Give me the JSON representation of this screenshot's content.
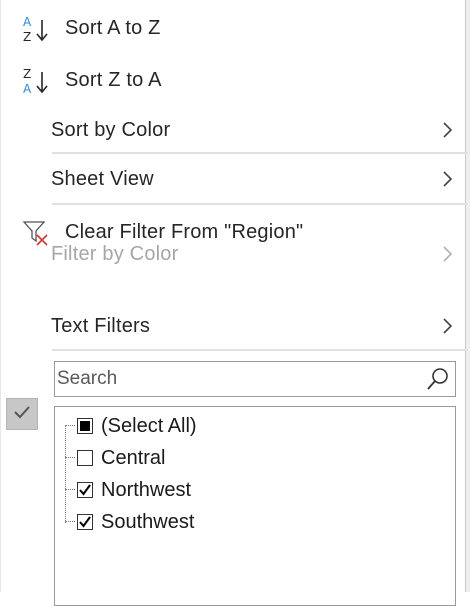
{
  "menu": {
    "sort_a_z": "Sort A to Z",
    "sort_z_a": "Sort Z to A",
    "sort_by_color": "Sort by Color",
    "sheet_view": "Sheet View",
    "clear_filter": "Clear Filter From \"Region\"",
    "filter_by_color": "Filter by Color",
    "text_filters": "Text Filters"
  },
  "search": {
    "placeholder": "Search"
  },
  "list": {
    "items": [
      {
        "label": "(Select All)",
        "state": "mixed"
      },
      {
        "label": "Central",
        "state": "unchecked"
      },
      {
        "label": "Northwest",
        "state": "checked"
      },
      {
        "label": "Southwest",
        "state": "checked"
      }
    ]
  },
  "colors": {
    "accent_blue": "#2b88d8",
    "clear_red": "#d13438",
    "disabled_text": "#a6a6a6"
  },
  "icons": [
    "sort-a-z-icon",
    "sort-z-a-icon",
    "clear-filter-icon",
    "chevron-right-icon",
    "search-icon",
    "checkmark-icon"
  ]
}
